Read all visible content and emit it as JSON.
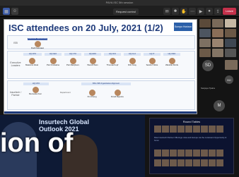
{
  "window": {
    "title": "PAYA ISC 5th session"
  },
  "toolbar": {
    "request_control": "Request control",
    "leave": "Leave"
  },
  "slide": {
    "title": "ISC attendees on 20 July, 2021 (1/2)",
    "logo_text": "Sompo Horizon",
    "sections": {
      "isb": "ISB",
      "executive": "Executive Leaders",
      "experts": "Insurtech / Partner"
    },
    "exec_label": "Executive Sponsorship",
    "depts": [
      "HQ CPO",
      "HQ CEO",
      "HQ CTO",
      "HQ HRO",
      "HQ CFO",
      "HQ CLO",
      "HQ IT",
      "HQ CMO"
    ],
    "people": [
      "Rudi Kasmawan",
      "Massimo Abaldo",
      "Piet Frustadner",
      "Piet Macpherson",
      "Wendt Wein",
      "Thomas Kopf",
      "Dirk Gray",
      "Sandor Nicks",
      "Wandile Dimbe",
      "Mercedes Fernandez",
      "Xin Cheng",
      "Dovid Reporter"
    ],
    "dept_extra": "Department",
    "alignment": "BSC-ISB Organization Alignment"
  },
  "participants": {
    "avatars": [
      "SD",
      "MJ",
      "M"
    ],
    "name_chip": "Sanjaya Tjakra"
  },
  "bottom_left": {
    "header_line1": "Insurtech Global",
    "header_line2": "Outlook 2021",
    "overlay": "ion of"
  },
  "bottom_right": {
    "title": "Round Tables",
    "body": "Raw Insurtech Partner Offerings: Asia and Europe via the consistent Opportunity & focus"
  },
  "colors": {
    "accent": "#1e3a7a",
    "leave": "#c4314b",
    "active_tab": "#3b5ba8"
  }
}
